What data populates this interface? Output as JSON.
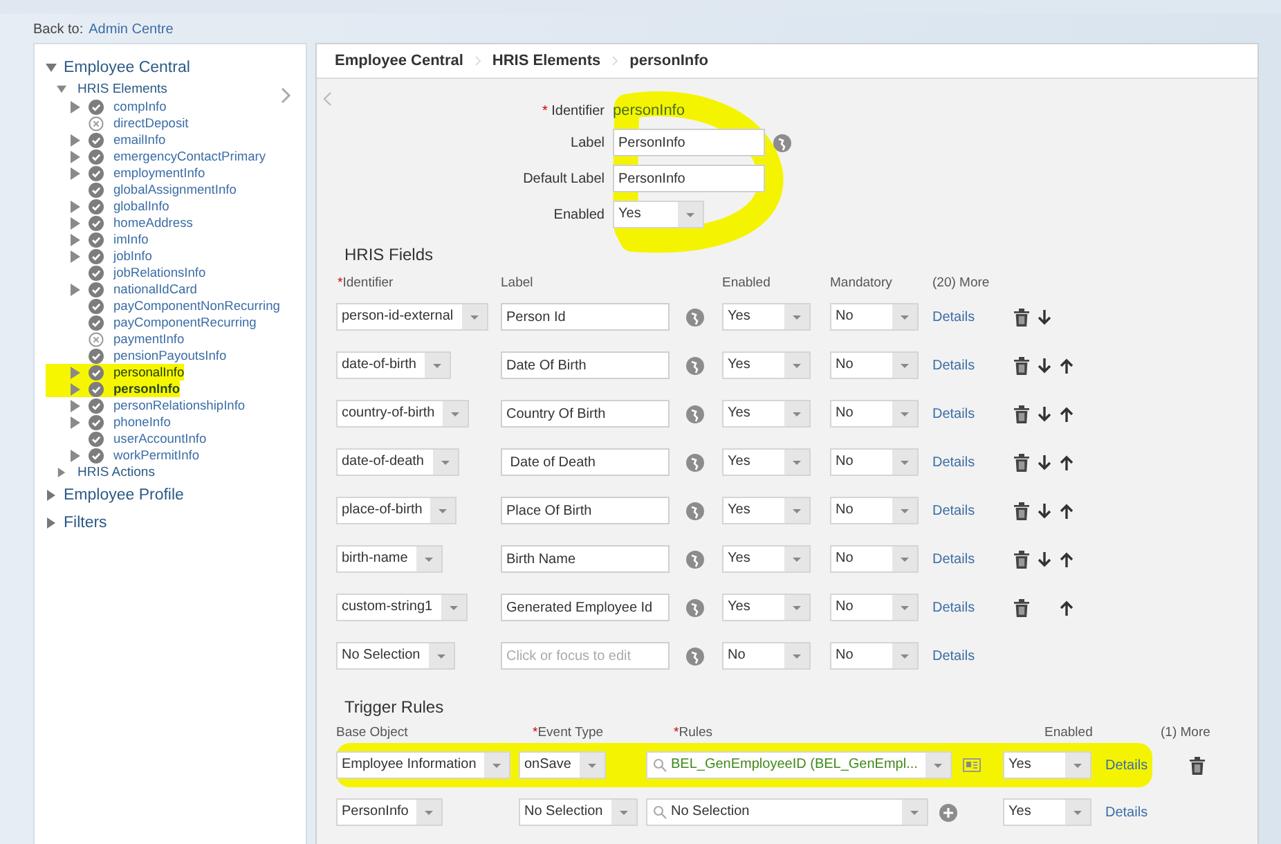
{
  "back": {
    "label": "Back to:",
    "link": "Admin Centre"
  },
  "sidebar": {
    "sections": [
      {
        "label": "Employee Central",
        "expanded": true,
        "children": [
          {
            "label": "HRIS Elements",
            "expanded": true,
            "children": [
              {
                "label": "compInfo",
                "ok": true,
                "expandable": true,
                "selected": false,
                "highlighted": false
              },
              {
                "label": "directDeposit",
                "ok": false,
                "expandable": false,
                "selected": false,
                "highlighted": false
              },
              {
                "label": "emailInfo",
                "ok": true,
                "expandable": true,
                "selected": false,
                "highlighted": false
              },
              {
                "label": "emergencyContactPrimary",
                "ok": true,
                "expandable": true,
                "selected": false,
                "highlighted": false
              },
              {
                "label": "employmentInfo",
                "ok": true,
                "expandable": true,
                "selected": false,
                "highlighted": false
              },
              {
                "label": "globalAssignmentInfo",
                "ok": true,
                "expandable": false,
                "selected": false,
                "highlighted": false
              },
              {
                "label": "globalInfo",
                "ok": true,
                "expandable": true,
                "selected": false,
                "highlighted": false
              },
              {
                "label": "homeAddress",
                "ok": true,
                "expandable": true,
                "selected": false,
                "highlighted": false
              },
              {
                "label": "imInfo",
                "ok": true,
                "expandable": true,
                "selected": false,
                "highlighted": false
              },
              {
                "label": "jobInfo",
                "ok": true,
                "expandable": true,
                "selected": false,
                "highlighted": false
              },
              {
                "label": "jobRelationsInfo",
                "ok": true,
                "expandable": false,
                "selected": false,
                "highlighted": false
              },
              {
                "label": "nationalIdCard",
                "ok": true,
                "expandable": true,
                "selected": false,
                "highlighted": false
              },
              {
                "label": "payComponentNonRecurring",
                "ok": true,
                "expandable": false,
                "selected": false,
                "highlighted": false
              },
              {
                "label": "payComponentRecurring",
                "ok": true,
                "expandable": false,
                "selected": false,
                "highlighted": false
              },
              {
                "label": "paymentInfo",
                "ok": false,
                "expandable": false,
                "selected": false,
                "highlighted": false
              },
              {
                "label": "pensionPayoutsInfo",
                "ok": true,
                "expandable": false,
                "selected": false,
                "highlighted": false
              },
              {
                "label": "personalInfo",
                "ok": true,
                "expandable": true,
                "selected": false,
                "highlighted": true
              },
              {
                "label": "personInfo",
                "ok": true,
                "expandable": true,
                "selected": true,
                "highlighted": true
              },
              {
                "label": "personRelationshipInfo",
                "ok": true,
                "expandable": true,
                "selected": false,
                "highlighted": false
              },
              {
                "label": "phoneInfo",
                "ok": true,
                "expandable": true,
                "selected": false,
                "highlighted": false
              },
              {
                "label": "userAccountInfo",
                "ok": true,
                "expandable": false,
                "selected": false,
                "highlighted": false
              },
              {
                "label": "workPermitInfo",
                "ok": true,
                "expandable": true,
                "selected": false,
                "highlighted": false
              }
            ]
          },
          {
            "label": "HRIS Actions",
            "expanded": false
          }
        ]
      },
      {
        "label": "Employee Profile",
        "expanded": false
      },
      {
        "label": "Filters",
        "expanded": false
      }
    ]
  },
  "breadcrumb": [
    "Employee Central",
    "HRIS Elements",
    "personInfo"
  ],
  "element_form": {
    "identifier_mark": "*",
    "identifier_label": "Identifier",
    "identifier": "personInfo",
    "label_label": "Label",
    "label": "PersonInfo",
    "default_label_label": "Default Label",
    "default_label": "PersonInfo",
    "enabled_label": "Enabled",
    "enabled": "Yes"
  },
  "hris_fields": {
    "title": "HRIS Fields",
    "columns": [
      {
        "mark": "*",
        "label": "Identifier"
      },
      {
        "label": "Label"
      },
      {
        "label": "Enabled"
      },
      {
        "label": "Mandatory"
      },
      {
        "label": "(20) More"
      }
    ],
    "rows": [
      {
        "identifier": "person-id-external",
        "label": "Person Id",
        "enabled": "Yes",
        "mandatory": "No",
        "details": "Details",
        "deletable": true,
        "move_down": true,
        "move_up": false
      },
      {
        "identifier": "date-of-birth",
        "label": "Date Of Birth",
        "enabled": "Yes",
        "mandatory": "No",
        "details": "Details",
        "deletable": true,
        "move_down": true,
        "move_up": true
      },
      {
        "identifier": "country-of-birth",
        "label": "Country Of Birth",
        "enabled": "Yes",
        "mandatory": "No",
        "details": "Details",
        "deletable": true,
        "move_down": true,
        "move_up": true
      },
      {
        "identifier": "date-of-death",
        "label": " Date of Death",
        "enabled": "Yes",
        "mandatory": "No",
        "details": "Details",
        "deletable": true,
        "move_down": true,
        "move_up": true
      },
      {
        "identifier": "place-of-birth",
        "label": "Place Of Birth",
        "enabled": "Yes",
        "mandatory": "No",
        "details": "Details",
        "deletable": true,
        "move_down": true,
        "move_up": true
      },
      {
        "identifier": "birth-name",
        "label": "Birth Name",
        "enabled": "Yes",
        "mandatory": "No",
        "details": "Details",
        "deletable": true,
        "move_down": true,
        "move_up": true
      },
      {
        "identifier": "custom-string1",
        "label": "Generated Employee Id",
        "enabled": "Yes",
        "mandatory": "No",
        "details": "Details",
        "deletable": true,
        "move_down": false,
        "move_up": true
      },
      {
        "identifier": "No Selection",
        "placeholder": "Click or focus to edit",
        "enabled": "No",
        "mandatory": "No",
        "details": "Details",
        "deletable": false,
        "move_down": false,
        "move_up": false
      }
    ]
  },
  "trigger_rules": {
    "title": "Trigger Rules",
    "columns": [
      {
        "label": "Base Object"
      },
      {
        "mark": "*",
        "label": "Event Type"
      },
      {
        "mark": "*",
        "label": "Rules"
      },
      {
        "label": "Enabled"
      },
      {
        "label": "(1) More"
      }
    ],
    "rows": [
      {
        "base_object": "Employee Information",
        "event_type": "onSave",
        "rule": "BEL_GenEmployeeID (BEL_GenEmpl...",
        "rule_set": true,
        "enabled": "Yes",
        "details": "Details",
        "deletable": true,
        "highlighted": true
      },
      {
        "base_object": "PersonInfo",
        "event_type": "No Selection",
        "rule": "No Selection",
        "rule_set": false,
        "enabled": "Yes",
        "details": "Details",
        "deletable": false,
        "highlighted": false
      }
    ]
  }
}
